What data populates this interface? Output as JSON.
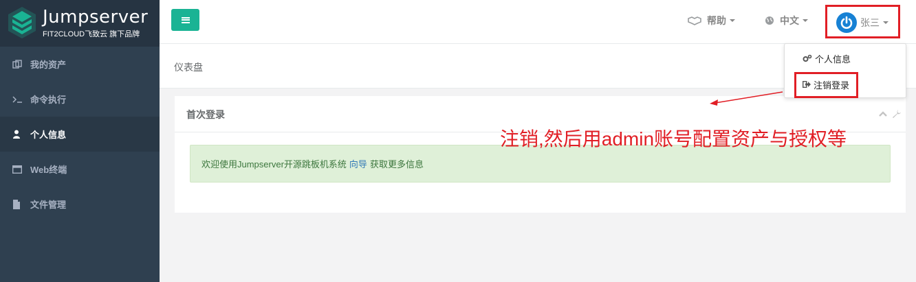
{
  "brand": {
    "title": "Jumpserver",
    "subtitle": "FIT2CLOUD飞致云 旗下品牌"
  },
  "sidebar": {
    "items": [
      {
        "label": "我的资产",
        "icon": "assets-icon",
        "active": false
      },
      {
        "label": "命令执行",
        "icon": "terminal-icon",
        "active": false
      },
      {
        "label": "个人信息",
        "icon": "user-icon",
        "active": true
      },
      {
        "label": "Web终端",
        "icon": "window-icon",
        "active": false
      },
      {
        "label": "文件管理",
        "icon": "file-icon",
        "active": false
      }
    ]
  },
  "topbar": {
    "help_label": "帮助",
    "lang_label": "中文",
    "user_name": "张三"
  },
  "breadcrumb": {
    "title": "仪表盘"
  },
  "panel": {
    "title": "首次登录",
    "alert_before": "欢迎使用Jumpserver开源跳板机系统",
    "alert_link": "向导",
    "alert_after": "获取更多信息"
  },
  "dropdown": {
    "profile_label": "个人信息",
    "logout_label": "注销登录"
  },
  "annotation": {
    "text": "注销,然后用admin账号配置资产与授权等"
  },
  "colors": {
    "sidebar_bg": "#2f4050",
    "accent": "#1ab394",
    "annotation_red": "#e11e25",
    "alert_bg": "#dff0d8",
    "link": "#337ab7"
  }
}
